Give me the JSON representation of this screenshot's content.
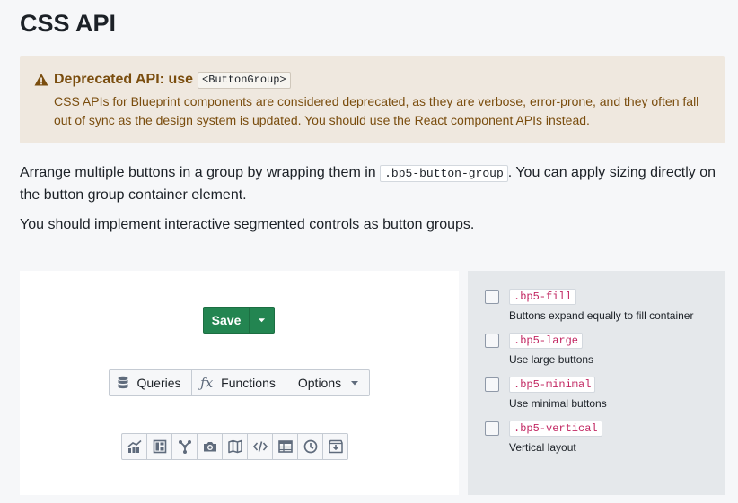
{
  "page": {
    "title": "CSS API"
  },
  "callout": {
    "title": "Deprecated API: use",
    "code": "<ButtonGroup>",
    "body": "CSS APIs for Blueprint components are considered deprecated, as they are verbose, error-prone, and they often fall out of sync as the design system is updated. You should use the React component APIs instead.",
    "color": "#7a4d0e"
  },
  "prose": {
    "p1_before": "Arrange multiple buttons in a group by wrapping them in ",
    "p1_code": ".bp5-button-group",
    "p1_after": ". You can apply sizing directly on the button group container element.",
    "p2": "You should implement interactive segmented controls as button groups."
  },
  "example": {
    "save_group": {
      "save_label": "Save",
      "color": "#238551"
    },
    "menu_group": {
      "queries_label": "Queries",
      "functions_label": "Functions",
      "options_label": "Options"
    },
    "icon_group": [
      "chart-icon",
      "dashboard-icon",
      "graph-icon",
      "camera-icon",
      "map-icon",
      "code-icon",
      "table-icon",
      "time-icon",
      "archive-icon"
    ]
  },
  "options": [
    {
      "code": ".bp5-fill",
      "label": "Buttons expand equally to fill container",
      "checked": false
    },
    {
      "code": ".bp5-large",
      "label": "Use large buttons",
      "checked": false
    },
    {
      "code": ".bp5-minimal",
      "label": "Use minimal buttons",
      "checked": false
    },
    {
      "code": ".bp5-vertical",
      "label": "Vertical layout",
      "checked": false
    }
  ]
}
